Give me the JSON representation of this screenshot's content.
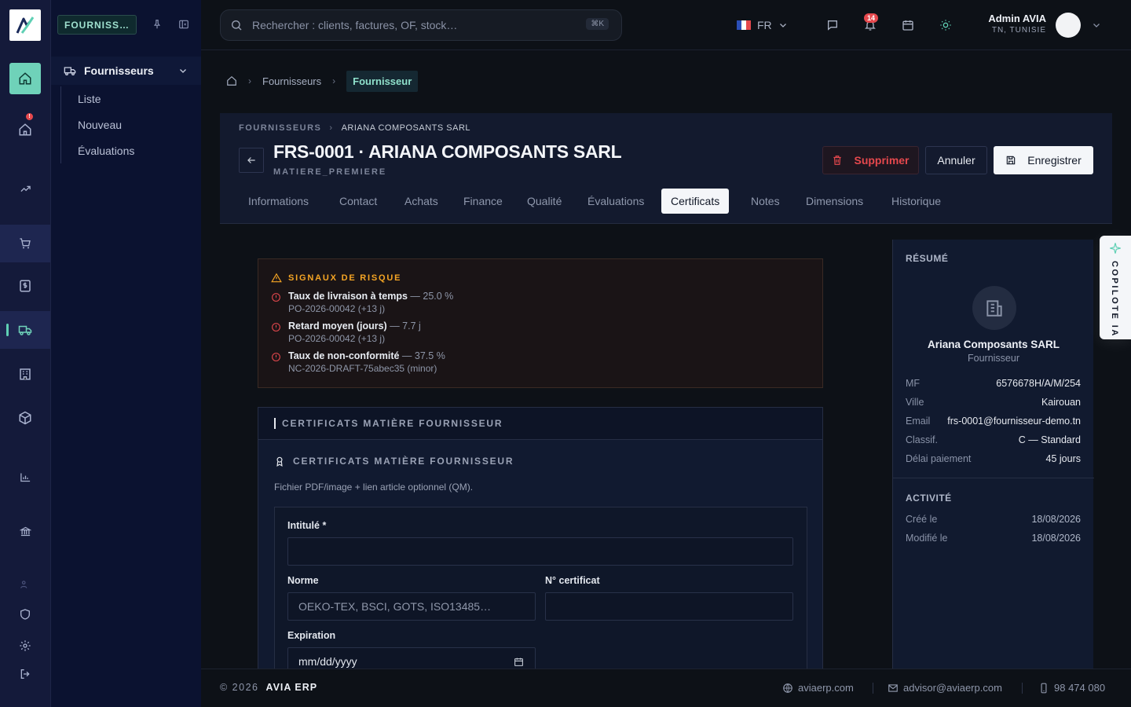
{
  "rail": {
    "logo": "logo-mark",
    "notification_dot": "!"
  },
  "sidebar": {
    "module_chip": "FOURNISS…",
    "section_title": "Fournisseurs",
    "items": [
      "Liste",
      "Nouveau",
      "Évaluations"
    ]
  },
  "topbar": {
    "search_placeholder": "Rechercher : clients, factures, OF, stock…",
    "search_shortcut": "⌘K",
    "language": "FR",
    "notifications_count": "14",
    "user_name": "Admin AVIA",
    "user_location": "TN, TUNISIE"
  },
  "breadcrumb": {
    "items": [
      "Fournisseurs",
      "Fournisseur"
    ]
  },
  "header": {
    "crumb_parent": "FOURNISSEURS",
    "crumb_current": "ARIANA COMPOSANTS SARL",
    "title": "FRS-0001 · ARIANA COMPOSANTS SARL",
    "subtitle": "MATIERE_PREMIERE",
    "delete_label": "Supprimer",
    "cancel_label": "Annuler",
    "save_label": "Enregistrer",
    "tabs": [
      "Informations",
      "Contact",
      "Achats",
      "Finance",
      "Qualité",
      "Évaluations",
      "Certificats",
      "Notes",
      "Dimensions",
      "Historique"
    ],
    "active_tab": "Certificats"
  },
  "risk": {
    "title": "SIGNAUX DE RISQUE",
    "items": [
      {
        "label": "Taux de livraison à temps",
        "value": "— 25.0 %",
        "ref": "PO-2026-00042 (+13 j)"
      },
      {
        "label": "Retard moyen (jours)",
        "value": "— 7.7 j",
        "ref": "PO-2026-00042 (+13 j)"
      },
      {
        "label": "Taux de non-conformité",
        "value": "— 37.5 %",
        "ref": "NC-2026-DRAFT-75abec35 (minor)"
      }
    ]
  },
  "cert": {
    "panel_title": "CERTIFICATS MATIÈRE FOURNISSEUR",
    "section_title": "CERTIFICATS MATIÈRE FOURNISSEUR",
    "description": "Fichier PDF/image + lien article optionnel (QM).",
    "intitule_label": "Intitulé *",
    "intitule_value": "",
    "norme_label": "Norme",
    "norme_placeholder": "OEKO-TEX, BSCI, GOTS, ISO13485…",
    "numero_label": "N° certificat",
    "numero_value": "",
    "expiration_label": "Expiration",
    "expiration_placeholder": "mm/dd/yyyy"
  },
  "resume": {
    "title": "RÉSUMÉ",
    "company": "Ariana Composants SARL",
    "role": "Fournisseur",
    "fields": [
      {
        "k": "MF",
        "v": "6576678H/A/M/254"
      },
      {
        "k": "Ville",
        "v": "Kairouan"
      },
      {
        "k": "Email",
        "v": "frs-0001@fournisseur-demo.tn"
      },
      {
        "k": "Classif.",
        "v": "C — Standard"
      },
      {
        "k": "Délai paiement",
        "v": "45 jours"
      }
    ],
    "activity_title": "ACTIVITÉ",
    "activity": [
      {
        "k": "Créé le",
        "v": "18/08/2026"
      },
      {
        "k": "Modifié le",
        "v": "18/08/2026"
      }
    ]
  },
  "copilot": {
    "label": "COPILOTE IA"
  },
  "footer": {
    "copyright": "© 2026",
    "brand": "AVIA ERP",
    "website": "aviaerp.com",
    "email": "advisor@aviaerp.com",
    "phone": "98 474 080"
  },
  "colors": {
    "accent": "#5fd0b4",
    "danger": "#e5484d",
    "warning": "#f5a524",
    "bg": "#0d1117"
  }
}
